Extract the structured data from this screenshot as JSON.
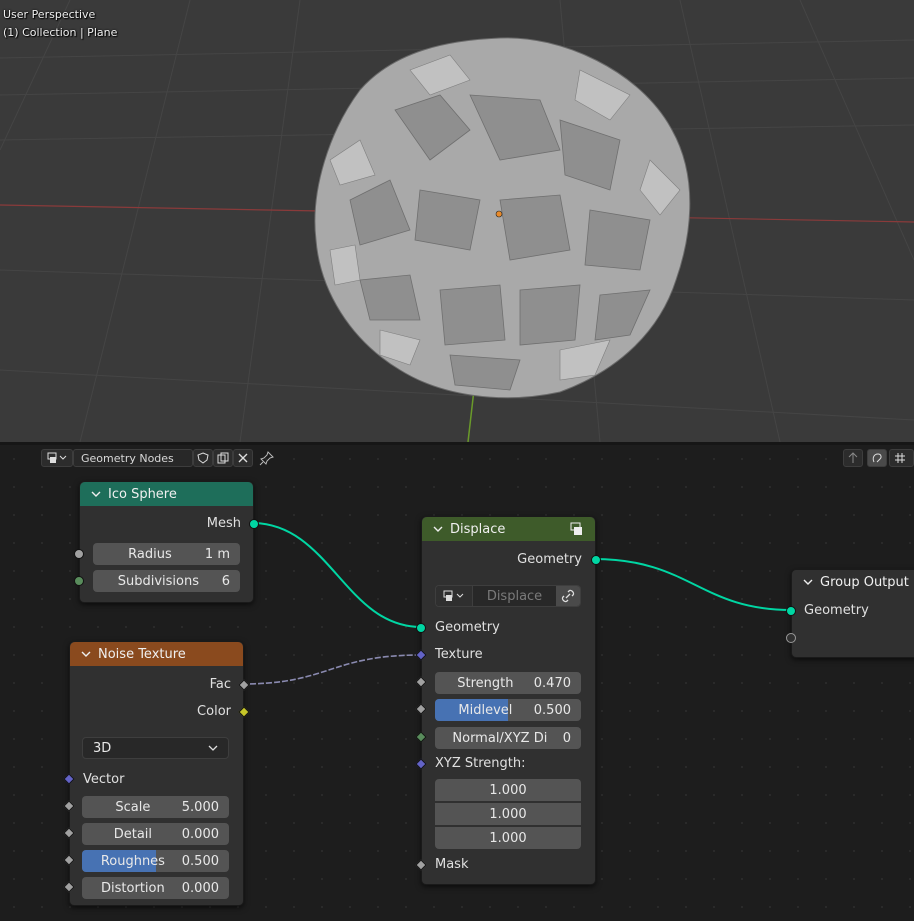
{
  "viewport": {
    "perspective_label": "User Perspective",
    "collection_label": "(1) Collection | Plane"
  },
  "editor": {
    "tree_name": "Geometry Nodes",
    "header_icons": [
      "editor-type-icon",
      "fake-user-shield-icon",
      "duplicate-icon",
      "close-icon",
      "pin-icon",
      "parent-up-icon",
      "snap-icon",
      "overlay-icon"
    ]
  },
  "nodes": {
    "ico_sphere": {
      "title": "Ico Sphere",
      "header_color": "#1e6e5a",
      "output_mesh": "Mesh",
      "radius_label": "Radius",
      "radius_value": "1 m",
      "subdivisions_label": "Subdivisions",
      "subdivisions_value": "6"
    },
    "noise_texture": {
      "title": "Noise Texture",
      "header_color": "#8a4a1e",
      "output_fac": "Fac",
      "output_color": "Color",
      "dimensions": "3D",
      "input_vector": "Vector",
      "scale_label": "Scale",
      "scale_value": "5.000",
      "detail_label": "Detail",
      "detail_value": "0.000",
      "roughness_label": "Roughnes",
      "roughness_value": "0.500",
      "roughness_fraction": 0.5,
      "distortion_label": "Distortion",
      "distortion_value": "0.000"
    },
    "displace": {
      "title": "Displace",
      "header_color": "#3e5b2a",
      "output_geometry": "Geometry",
      "texture_placeholder": "Displace",
      "input_geometry": "Geometry",
      "input_texture": "Texture",
      "strength_label": "Strength",
      "strength_value": "0.470",
      "midlevel_label": "Midlevel",
      "midlevel_value": "0.500",
      "midlevel_fraction": 0.5,
      "normal_label": "Normal/XYZ Di",
      "normal_value": "0",
      "xyz_label": "XYZ Strength:",
      "xyz_values": [
        "1.000",
        "1.000",
        "1.000"
      ],
      "mask_label": "Mask"
    },
    "group_output": {
      "title": "Group Output",
      "header_color": "#303030",
      "input_geometry": "Geometry"
    }
  },
  "colors": {
    "geometry_socket": "#00d6a3",
    "vector_socket": "#6363c7",
    "float_socket": "#a1a1a1",
    "color_socket": "#c7c729",
    "int_socket": "#598c5c",
    "accent_blue": "#4772b3"
  }
}
